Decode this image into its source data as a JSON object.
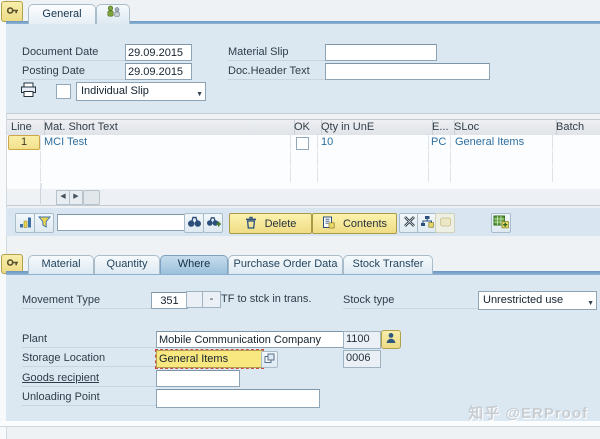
{
  "header_tabs": {
    "general": "General"
  },
  "header": {
    "document_date_label": "Document Date",
    "document_date_value": "29.09.2015",
    "posting_date_label": "Posting Date",
    "posting_date_value": "29.09.2015",
    "material_slip_label": "Material Slip",
    "doc_header_text_label": "Doc.Header Text",
    "slip_select_value": "Individual Slip"
  },
  "items_table": {
    "columns": [
      "Line",
      "Mat. Short Text",
      "OK",
      "Qty in UnE",
      "E...",
      "SLoc",
      "Batch"
    ],
    "rows": [
      {
        "line": "1",
        "short_text": "MCI Test",
        "qty": "10",
        "eun": "PC",
        "sloc": "General Items",
        "batch": ""
      }
    ]
  },
  "toolbar": {
    "delete_label": "Delete",
    "contents_label": "Contents"
  },
  "detail_tabs": [
    "Material",
    "Quantity",
    "Where",
    "Purchase Order Data",
    "Stock Transfer"
  ],
  "active_detail_tab": "Where",
  "detail": {
    "movement_type_label": "Movement Type",
    "movement_type_value": "351",
    "movement_type_dash": "-",
    "movement_type_desc": "TF to stck in trans.",
    "stock_type_label": "Stock type",
    "stock_type_value": "Unrestricted use",
    "plant_label": "Plant",
    "plant_value": "Mobile Communication Company",
    "plant_code": "1100",
    "storage_location_label": "Storage Location",
    "storage_location_value": "General Items",
    "storage_location_code": "0006",
    "goods_recipient_label": "Goods recipient",
    "unloading_point_label": "Unloading Point"
  },
  "watermark": {
    "text": "知乎 @ERProof"
  },
  "icons": {
    "dropdown_arrow": "▼",
    "scroll_left": "◀",
    "scroll_right": "▶"
  },
  "colors": {
    "panel_bg": "#dbe8f2",
    "accent_yellow": "#f5e9a2",
    "active_tab_blue": "#9cc0dc",
    "value_blue": "#2f6f9f",
    "focus_red": "#c84b3f"
  }
}
